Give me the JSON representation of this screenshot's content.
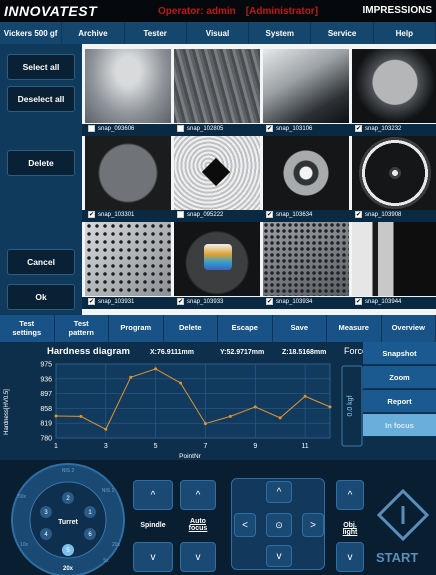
{
  "header": {
    "logo": "INNOVATEST",
    "operator": "Operator: admin",
    "role": "[Administrator]",
    "mode": "IMPRESSIONS"
  },
  "menu": [
    "Vickers 500 gf",
    "Archive",
    "Tester",
    "Visual",
    "System",
    "Service",
    "Help"
  ],
  "side": {
    "select_all": "Select all",
    "deselect_all": "Deselect all",
    "delete": "Delete",
    "cancel": "Cancel",
    "ok": "Ok"
  },
  "snaps": [
    {
      "name": "snap_093606",
      "checked": false,
      "check": ""
    },
    {
      "name": "snap_102805",
      "checked": false,
      "check": ""
    },
    {
      "name": "snap_103106",
      "checked": true,
      "check": "✔"
    },
    {
      "name": "snap_103232",
      "checked": true,
      "check": "✔"
    },
    {
      "name": "snap_103301",
      "checked": true,
      "check": "✔"
    },
    {
      "name": "snap_095222",
      "checked": false,
      "check": ""
    },
    {
      "name": "snap_103634",
      "checked": true,
      "check": "✔"
    },
    {
      "name": "snap_103908",
      "checked": true,
      "check": "✔"
    },
    {
      "name": "snap_103931",
      "checked": true,
      "check": "✔"
    },
    {
      "name": "snap_103933",
      "checked": true,
      "check": "✔"
    },
    {
      "name": "snap_103934",
      "checked": true,
      "check": "✔"
    },
    {
      "name": "snap_103944",
      "checked": true,
      "check": "✔"
    }
  ],
  "tabs": [
    {
      "l1": "Test",
      "l2": "settings"
    },
    {
      "l1": "Test",
      "l2": "pattern"
    },
    {
      "l1": "Program",
      "l2": ""
    },
    {
      "l1": "Delete",
      "l2": ""
    },
    {
      "l1": "Escape",
      "l2": ""
    },
    {
      "l1": "Save",
      "l2": ""
    },
    {
      "l1": "Measure",
      "l2": ""
    },
    {
      "l1": "Overview",
      "l2": ""
    }
  ],
  "diagram": {
    "title": "Hardness diagram",
    "x": "X:76.9111mm",
    "y": "Y:52.9717mm",
    "z": "Z:18.5168mm"
  },
  "force": {
    "label": "Force",
    "value": "0.0 kgf"
  },
  "right_buttons": [
    "Snapshot",
    "Zoom",
    "Report",
    "In focus"
  ],
  "chart_data": {
    "type": "line",
    "title": "Hardness diagram",
    "xlabel": "PointNr",
    "ylabel": "Hardness[HV0.5]",
    "x": [
      1,
      2,
      3,
      4,
      5,
      6,
      7,
      8,
      9,
      10,
      11,
      12
    ],
    "values": [
      838,
      837,
      803,
      940,
      962,
      925,
      818,
      837,
      862,
      833,
      890,
      862
    ],
    "ylim": [
      780,
      975
    ],
    "xlim": [
      1,
      12
    ],
    "yticks": [
      "975",
      "936",
      "897",
      "858",
      "819",
      "780"
    ],
    "xticks": [
      "1",
      "3",
      "5",
      "7",
      "9",
      "11"
    ],
    "color": "#e09430",
    "grid": true
  },
  "controls": {
    "turret": "Turret",
    "turret_mag": "20x",
    "positions": [
      "1",
      "2",
      "3",
      "4",
      "5",
      "6"
    ],
    "ring": [
      "NIS 2",
      "NIS 1",
      "20x",
      "10x",
      "50x",
      "5x"
    ],
    "spindle": "Spindle",
    "auto1": "Auto",
    "auto2": "focus",
    "obj1": "Obj.",
    "obj2": "light",
    "start": "START",
    "up": "^",
    "down": "v",
    "left": "<",
    "right": ">",
    "center": "⊙"
  }
}
